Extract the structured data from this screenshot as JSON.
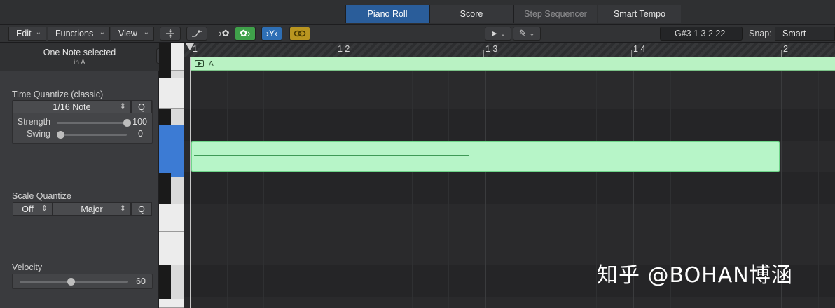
{
  "tabs": [
    {
      "label": "Piano Roll",
      "active": true
    },
    {
      "label": "Score",
      "active": false
    },
    {
      "label": "Step Sequencer",
      "active": false
    },
    {
      "label": "Smart Tempo",
      "active": false
    }
  ],
  "toolbar": {
    "edit_label": "Edit",
    "functions_label": "Functions",
    "view_label": "View",
    "position_display": "G#3   1 3 2 22",
    "snap_label": "Snap:",
    "snap_value": "Smart"
  },
  "inspector": {
    "title": "One Note selected",
    "subtitle": "in A",
    "time_quantize": {
      "label": "Time Quantize (classic)",
      "value": "1/16 Note",
      "q_label": "Q",
      "strength_label": "Strength",
      "strength_value": "100",
      "strength_fraction": 1.0,
      "swing_label": "Swing",
      "swing_value": "0",
      "swing_fraction": 0.0
    },
    "scale_quantize": {
      "label": "Scale Quantize",
      "root_value": "Off",
      "scale_value": "Major",
      "q_label": "Q"
    },
    "velocity": {
      "label": "Velocity",
      "value": "60",
      "fraction": 0.47
    }
  },
  "ruler": {
    "labels": [
      "1",
      "1 2",
      "1 3",
      "1 4",
      "2"
    ]
  },
  "region": {
    "name": "A",
    "color": "#b9f2c3"
  },
  "note": {
    "pitch": "G#3",
    "color": "#b7f5c8"
  },
  "accents": {
    "active_tab": "#2a5d9a",
    "green_button": "#3fa14a",
    "blue_button": "#2e6fb5",
    "yellow_button": "#b99520"
  },
  "watermark": "知乎 @BOHAN博涵"
}
